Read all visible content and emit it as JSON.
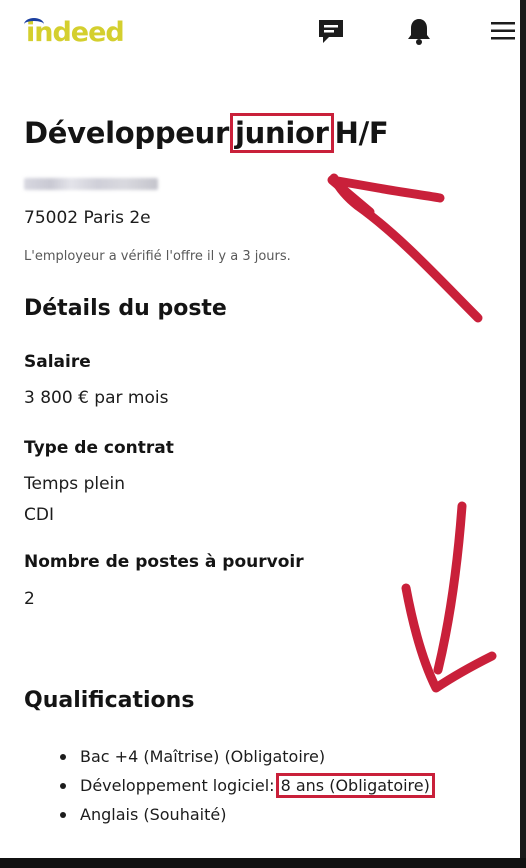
{
  "header": {
    "logo_text": "indeed",
    "icons": [
      "message-icon",
      "bell-icon",
      "menu-icon"
    ]
  },
  "job": {
    "title_before": "Développeur",
    "title_highlight": "junior",
    "title_after": "H/F",
    "location": "75002 Paris 2e",
    "verified_text": "L'employeur a vérifié l'offre il y a 3 jours."
  },
  "details": {
    "section_title": "Détails du poste",
    "salary_label": "Salaire",
    "salary_value": "3 800 € par mois",
    "contract_label": "Type de contrat",
    "contract_values": [
      "Temps plein",
      "CDI"
    ],
    "positions_label": "Nombre de postes à pourvoir",
    "positions_value": "2"
  },
  "qualifications": {
    "section_title": "Qualifications",
    "items": [
      {
        "text": "Bac +4 (Maîtrise) (Obligatoire)"
      },
      {
        "text_before": "Développement logiciel:",
        "text_highlight": "8 ans (Obligatoire)"
      },
      {
        "text": "Anglais (Souhaité)"
      }
    ]
  },
  "colors": {
    "annotation_red": "#c9203a",
    "logo_yellow": "#d4cf2e",
    "logo_blue": "#1b3fa0"
  }
}
